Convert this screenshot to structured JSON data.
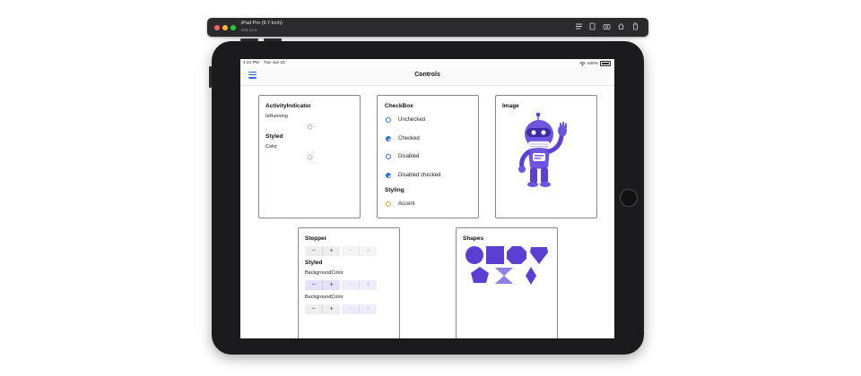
{
  "simulator": {
    "device_name": "iPad Pro (9.7-inch)",
    "os_version": "iOS 14.5",
    "icons": [
      "screenshot-icon",
      "home-icon",
      "rotate-icon",
      "camera-icon",
      "duplicate-icon"
    ]
  },
  "status_bar": {
    "time": "4:21 PM",
    "date": "Tue Jun 15",
    "battery": "100%"
  },
  "nav": {
    "title": "Controls"
  },
  "activity_card": {
    "title": "ActivityIndicator",
    "is_running_label": "IsRunning",
    "styled_heading": "Styled",
    "color_label": "Color"
  },
  "checkbox_card": {
    "title": "CheckBox",
    "items": [
      {
        "label": "Unchecked",
        "checked": false
      },
      {
        "label": "Checked",
        "checked": true
      },
      {
        "label": "Disabled",
        "checked": false
      },
      {
        "label": "Disabled checked",
        "checked": true
      }
    ],
    "styling_heading": "Styling",
    "accent_label": "Accent"
  },
  "image_card": {
    "title": "Image"
  },
  "stepper_card": {
    "title": "Stepper",
    "styled_heading": "Styled",
    "bg_label_1": "BackgroundColor",
    "bg_label_2": "BackgroundColor",
    "minus": "−",
    "plus": "+"
  },
  "shapes_card": {
    "title": "Shapes",
    "shape_color": "#5b3fd3"
  },
  "colors": {
    "accent_blue": "#2f6fe0",
    "brand_purple": "#5b3fd3"
  }
}
